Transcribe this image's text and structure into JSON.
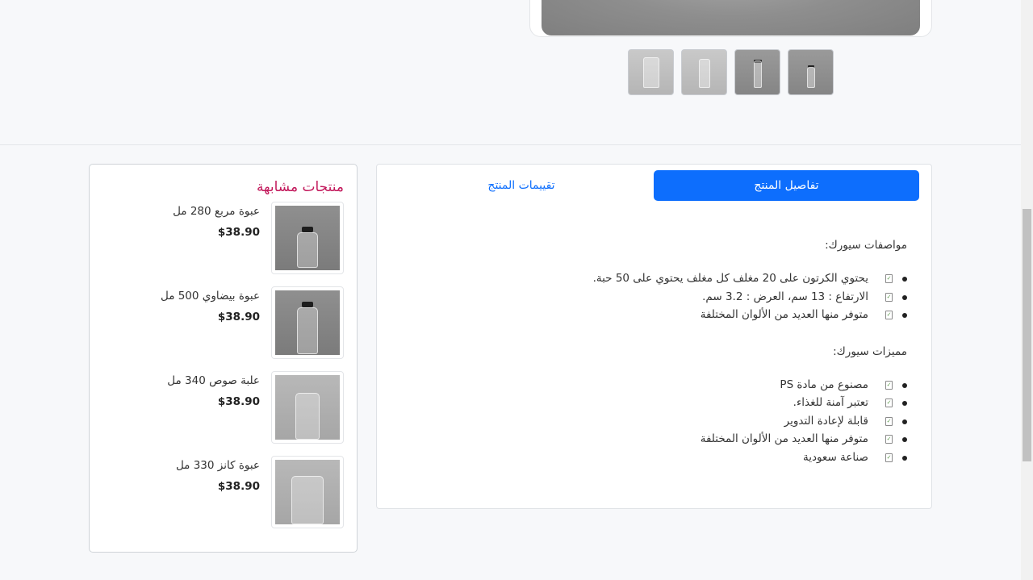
{
  "gallery": {
    "thumbnails": [
      {
        "name": "thumb-1"
      },
      {
        "name": "thumb-2"
      },
      {
        "name": "thumb-3"
      },
      {
        "name": "thumb-4"
      }
    ]
  },
  "tabs": {
    "details_label": "تفاصيل المنتج",
    "reviews_label": "تقييمات المنتج"
  },
  "specs": {
    "heading": "مواصفات سيورك:",
    "items": [
      "يحتوي الكرتون على 20 مغلف كل مغلف يحتوي على 50 حبة.",
      "الارتفاع : 13 سم، العرض : 3.2 سم.",
      "متوفر منها العديد من الألوان المختلفة"
    ]
  },
  "features": {
    "heading": "مميزات سيورك:",
    "items": [
      "مصنوع من مادة PS",
      "تعتبر آمنة للغذاء.",
      "قابلة لإعادة التدوير",
      "متوفر منها العديد من الألوان المختلفة",
      "صناعة سعودية"
    ]
  },
  "similar": {
    "title": "منتجات مشابهة",
    "products": [
      {
        "name": "عبوة مربع 280 مل",
        "price": "$38.90"
      },
      {
        "name": "عبوة بيضاوي 500 مل",
        "price": "$38.90"
      },
      {
        "name": "علبة صوص 340 مل",
        "price": "$38.90"
      },
      {
        "name": "عبوة كانز 330 مل",
        "price": "$38.90"
      }
    ]
  },
  "colors": {
    "accent": "#0d6efd",
    "similar_title": "#c2185b",
    "background": "#f7f8fa"
  }
}
